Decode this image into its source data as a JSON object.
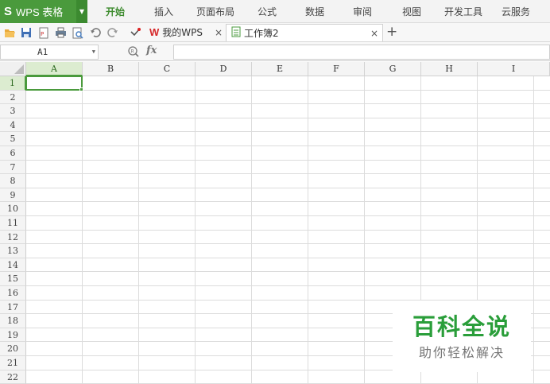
{
  "app": {
    "logo_letter": "S",
    "title": "WPS 表格",
    "accent": "#4a9a3c"
  },
  "menu": [
    {
      "label": "开始",
      "active": true
    },
    {
      "label": "插入"
    },
    {
      "label": "页面布局"
    },
    {
      "label": "公式"
    },
    {
      "label": "数据"
    },
    {
      "label": "审阅"
    },
    {
      "label": "视图"
    },
    {
      "label": "开发工具"
    },
    {
      "label": "云服务"
    }
  ],
  "toolbar": {
    "icons": [
      "open-folder-icon",
      "save-icon",
      "export-pdf-icon",
      "print-icon",
      "print-preview-icon",
      "undo-icon",
      "redo-icon",
      "customize-toolbar-icon"
    ],
    "tabs": [
      {
        "label": "我的WPS",
        "close": "×",
        "icon": "wps-logo-icon"
      },
      {
        "label": "工作簿2",
        "close": "×",
        "icon": "spreadsheet-doc-icon"
      }
    ],
    "new_tab": "+"
  },
  "formula_bar": {
    "name_box": "A1",
    "fx": "fx",
    "formula": ""
  },
  "sheet": {
    "columns": [
      "A",
      "B",
      "C",
      "D",
      "E",
      "F",
      "G",
      "H",
      "I"
    ],
    "rows": [
      "1",
      "2",
      "3",
      "4",
      "5",
      "6",
      "7",
      "8",
      "9",
      "10",
      "11",
      "12",
      "13",
      "14",
      "15",
      "16",
      "17",
      "18",
      "19",
      "20",
      "21",
      "22"
    ],
    "selected_column": "A",
    "selected_row": "1"
  },
  "watermark": {
    "title": "百科全说",
    "subtitle": "助你轻松解决",
    "color": "#2a9e3a"
  }
}
